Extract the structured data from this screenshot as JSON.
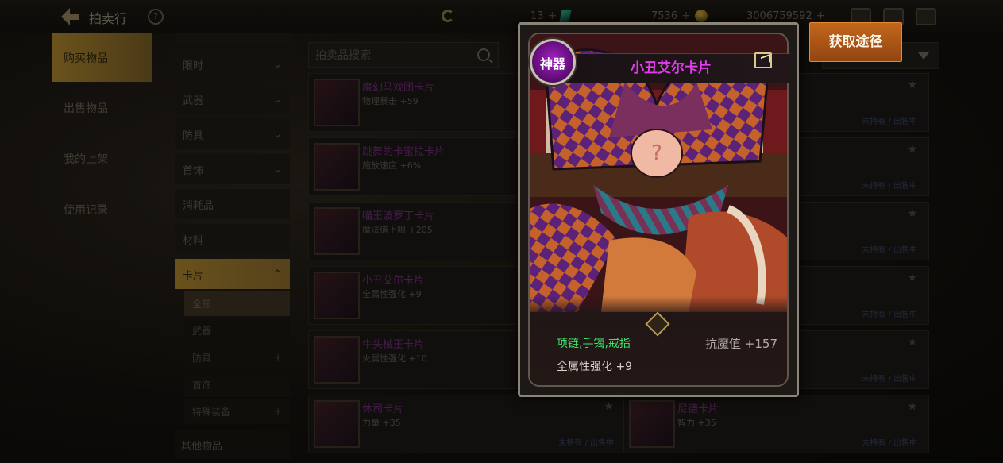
{
  "topbar": {
    "title": "拍卖行",
    "help_label": "?",
    "currency_a": "13",
    "currency_b": "7536",
    "currency_c": "3006759592"
  },
  "left_nav": [
    {
      "label": "购买物品",
      "active": true
    },
    {
      "label": "出售物品",
      "active": false
    },
    {
      "label": "我的上架",
      "active": false
    },
    {
      "label": "使用记录",
      "active": false
    }
  ],
  "categories": {
    "c0": "限时",
    "c1": "武器",
    "c2": "防具",
    "c3": "首饰",
    "c4": "消耗品",
    "c5": "材料",
    "c6": "卡片",
    "s0": "全部",
    "s1": "武器",
    "s2": "防具",
    "s3": "首饰",
    "s4": "特殊装备",
    "last": "其他物品"
  },
  "search": {
    "placeholder": "拍卖品搜索"
  },
  "listing": [
    {
      "name": "魔幻马戏团卡片",
      "stat": "物理暴击 +59"
    },
    {
      "name": "跳舞的卡蜜拉卡片",
      "stat": "施放速度 +6%"
    },
    {
      "name": "喵王波罗丁卡片",
      "stat": "魔法值上限 +205"
    },
    {
      "name": "小丑艾尔卡片",
      "stat": "全属性强化 +9"
    },
    {
      "name": "牛头械王卡片",
      "stat": "火属性强化 +10"
    },
    {
      "name": "休司卡片",
      "stat": "力量 +35"
    }
  ],
  "listing_status": "未持有 / 出售中",
  "right_list": [
    {
      "name": "",
      "stat": ""
    },
    {
      "name": "",
      "stat": ""
    },
    {
      "name": "",
      "stat": ""
    },
    {
      "name": "",
      "stat": ""
    },
    {
      "name": "",
      "stat": ""
    },
    {
      "name": "尼德卡片",
      "stat": "智力 +35"
    }
  ],
  "card": {
    "rarity_badge": "神器",
    "title": "小丑艾尔卡片",
    "slots": "项链,手镯,戒指",
    "resist": "抗魔值 +157",
    "effect": "全属性强化 +9"
  },
  "get_source_button": "获取途径",
  "colors": {
    "title_purple": "#e33bf0",
    "slot_green": "#41e26a",
    "button_orange": "#c2661d"
  }
}
